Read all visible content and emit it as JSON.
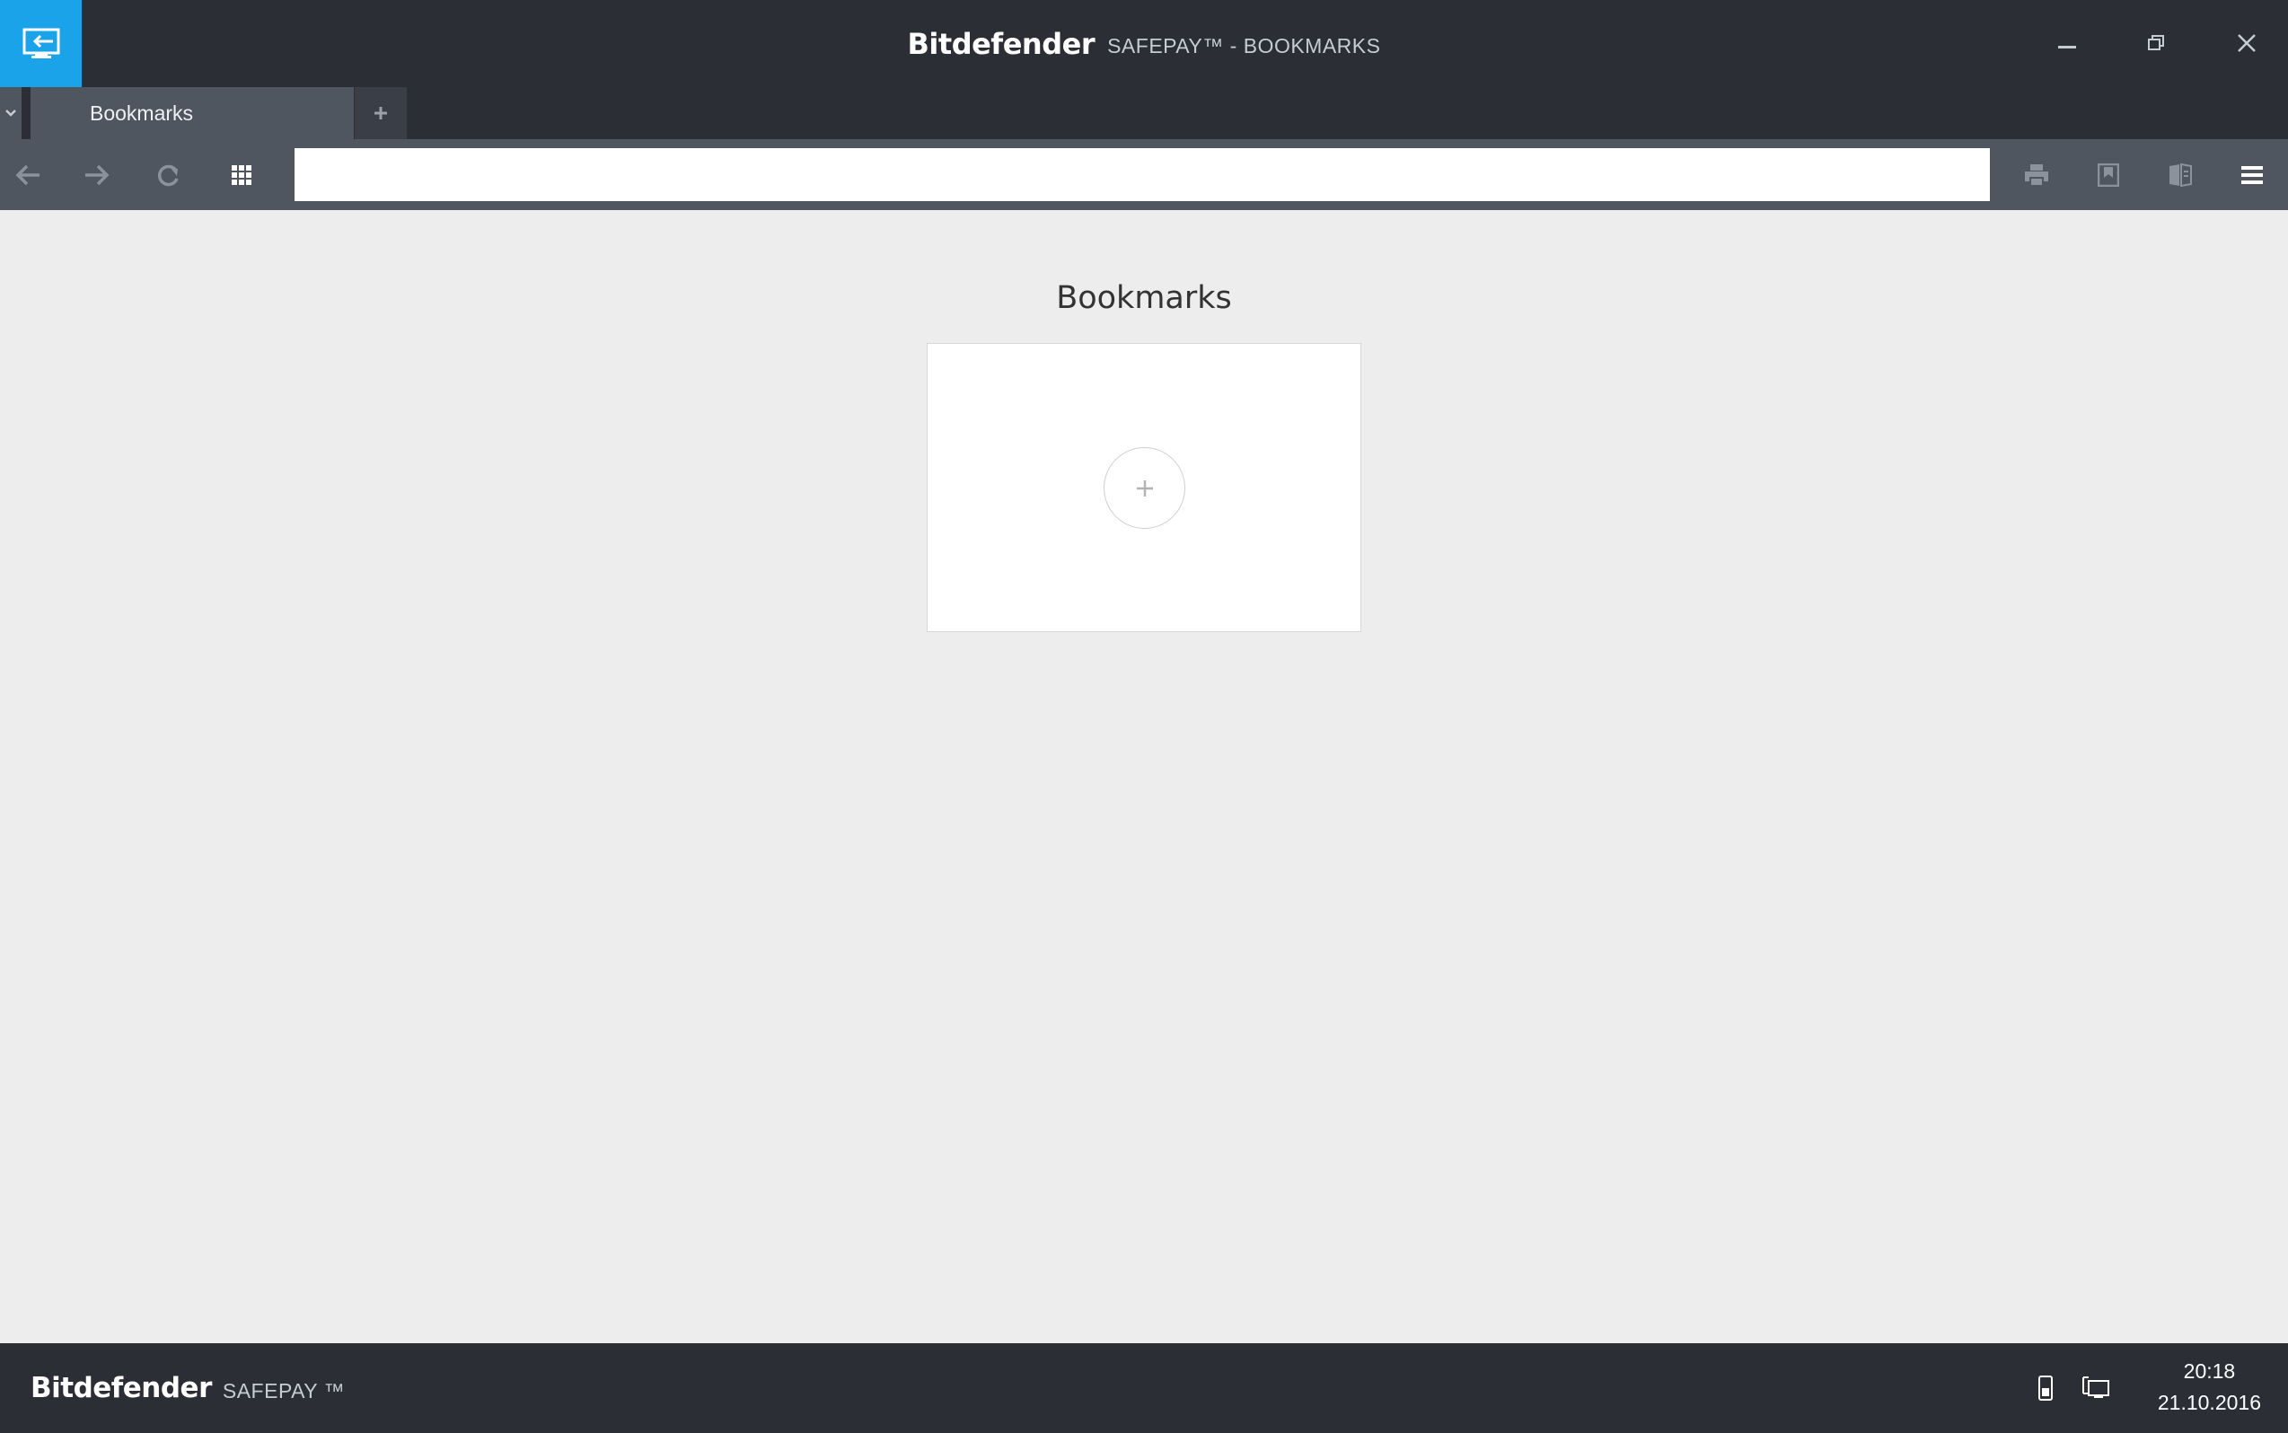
{
  "window": {
    "brand": "Bitdefender",
    "title": "SAFEPAY™ - BOOKMARKS"
  },
  "tabs": [
    {
      "label": "Bookmarks",
      "active": true
    }
  ],
  "address_bar": {
    "value": "",
    "placeholder": ""
  },
  "page": {
    "heading": "Bookmarks"
  },
  "footer": {
    "brand": "Bitdefender",
    "product": "SAFEPAY ™",
    "time": "20:18",
    "date": "21.10.2016"
  },
  "icons": {
    "app": "exit-to-desktop-icon",
    "minimize": "minimize-icon",
    "restore": "restore-icon",
    "close": "close-icon",
    "tab_list": "chevron-down-icon",
    "new_tab": "plus-icon",
    "back": "arrow-left-icon",
    "forward": "arrow-right-icon",
    "reload": "reload-icon",
    "grid": "grid-icon",
    "print": "print-icon",
    "bookmark": "bookmark-icon",
    "keyboard": "virtual-keyboard-icon",
    "menu": "hamburger-menu-icon",
    "add_bookmark": "plus-icon",
    "phone": "phone-icon",
    "network": "network-icon"
  },
  "colors": {
    "accent": "#1aa3e8",
    "chrome_dark": "#2b2f35",
    "chrome_mid": "#50565f",
    "content_bg": "#ededed"
  }
}
